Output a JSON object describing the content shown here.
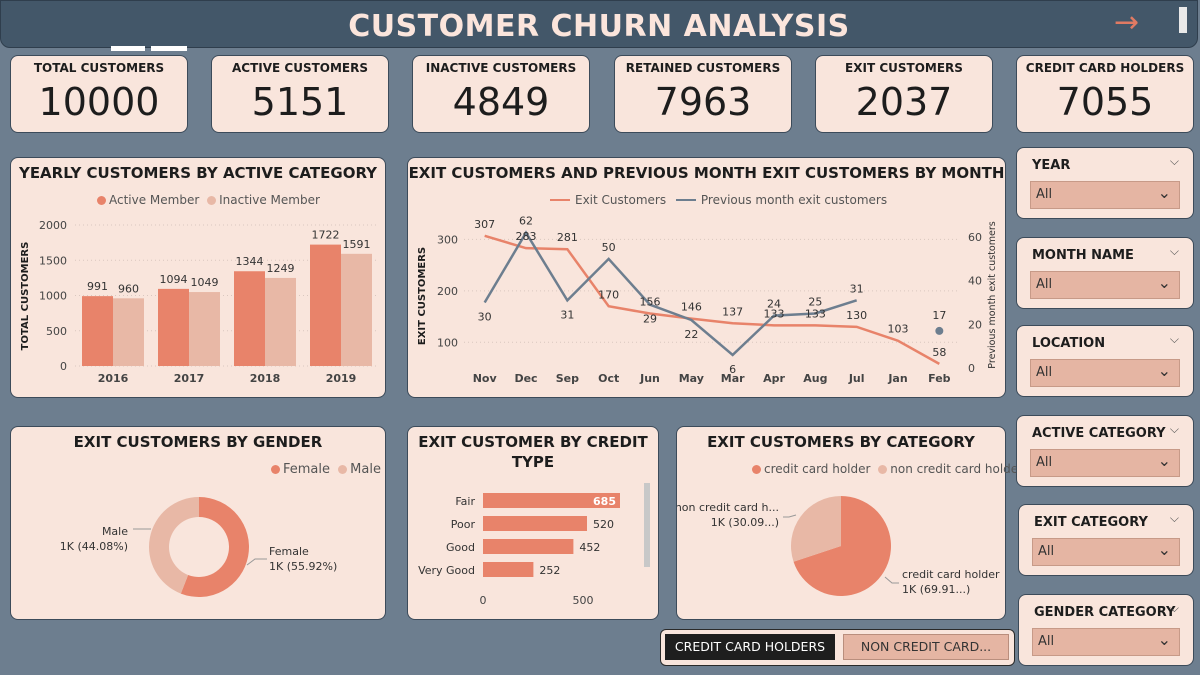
{
  "header": {
    "title": "CUSTOMER CHURN ANALYSIS",
    "nav_icon": "arrow-right-icon"
  },
  "kpis": [
    {
      "label": "TOTAL CUSTOMERS",
      "value": "10000"
    },
    {
      "label": "ACTIVE CUSTOMERS",
      "value": "5151"
    },
    {
      "label": "INACTIVE CUSTOMERS",
      "value": "4849"
    },
    {
      "label": "RETAINED CUSTOMERS",
      "value": "7963"
    },
    {
      "label": "EXIT CUSTOMERS",
      "value": "2037"
    },
    {
      "label": "CREDIT CARD HOLDERS",
      "value": "7055"
    }
  ],
  "colors": {
    "accent": "#e8836a",
    "accent_light": "#e8b8a6",
    "slate": "#6d7e8f",
    "card": "#f9e5dc"
  },
  "slicers": [
    {
      "label": "YEAR",
      "value": "All"
    },
    {
      "label": "MONTH NAME",
      "value": "All"
    },
    {
      "label": "LOCATION",
      "value": "All"
    },
    {
      "label": "ACTIVE CATEGORY",
      "value": "All"
    },
    {
      "label": "EXIT CATEGORY",
      "value": "All"
    },
    {
      "label": "GENDER CATEGORY",
      "value": "All"
    }
  ],
  "buttons": {
    "credit": "CREDIT CARD HOLDERS",
    "noncredit": "NON CREDIT CARD..."
  },
  "chart_data": [
    {
      "id": "yearly",
      "type": "bar",
      "title": "YEARLY CUSTOMERS BY ACTIVE CATEGORY",
      "ylabel": "TOTAL CUSTOMERS",
      "categories": [
        "2016",
        "2017",
        "2018",
        "2019"
      ],
      "series": [
        {
          "name": "Active Member",
          "values": [
            991,
            1094,
            1344,
            1722
          ],
          "color": "#e8836a"
        },
        {
          "name": "Inactive Member",
          "values": [
            960,
            1049,
            1249,
            1591
          ],
          "color": "#e8b8a6"
        }
      ],
      "yticks": [
        "0",
        "500",
        "1000",
        "1500",
        "2000"
      ],
      "ylim": [
        0,
        2000
      ]
    },
    {
      "id": "monthly",
      "type": "line",
      "title": "EXIT CUSTOMERS AND PREVIOUS MONTH EXIT CUSTOMERS BY MONTH",
      "ylabel": "EXIT CUSTOMERS",
      "y2label": "Previous month exit customers",
      "categories": [
        "Nov",
        "Dec",
        "Sep",
        "Oct",
        "Jun",
        "May",
        "Mar",
        "Apr",
        "Aug",
        "Jul",
        "Jan",
        "Feb"
      ],
      "series": [
        {
          "name": "Exit Customers",
          "values": [
            307,
            283,
            281,
            170,
            156,
            146,
            137,
            133,
            133,
            130,
            103,
            58
          ],
          "axis": "left",
          "color": "#e8836a"
        },
        {
          "name": "Previous month exit customers",
          "values": [
            30,
            62,
            31,
            50,
            29,
            22,
            6,
            24,
            25,
            31,
            null,
            17
          ],
          "axis": "right",
          "color": "#6d7e8f"
        }
      ],
      "point_labels_left": [
        "307",
        "283",
        "281",
        "170",
        "156",
        "146",
        "137",
        "133",
        "133",
        "130",
        "103",
        "58"
      ],
      "point_labels_right": [
        "30",
        "62",
        "31",
        "50",
        "29",
        "22",
        "6",
        "24",
        "25",
        "31",
        "",
        "17"
      ],
      "yticks": [
        "100",
        "200",
        "300"
      ],
      "y2ticks": [
        "0",
        "20",
        "40",
        "60"
      ],
      "ylim": [
        50,
        330
      ],
      "y2lim": [
        0,
        66
      ]
    },
    {
      "id": "gender",
      "type": "pie",
      "title": "EXIT CUSTOMERS BY GENDER",
      "labels": [
        "Female",
        "Male"
      ],
      "values": [
        55.92,
        44.08
      ],
      "data_labels": [
        [
          "Female",
          "1K (55.92%)"
        ],
        [
          "Male",
          "1K (44.08%)"
        ]
      ],
      "colors": [
        "#e8836a",
        "#e8b8a6"
      ]
    },
    {
      "id": "credit",
      "type": "bar",
      "title": "EXIT CUSTOMER BY CREDIT TYPE",
      "categories": [
        "Fair",
        "Poor",
        "Good",
        "Very Good"
      ],
      "values": [
        685,
        520,
        452,
        252
      ],
      "value_labels": [
        "685",
        "520",
        "452",
        "252"
      ],
      "xticks": [
        "0",
        "500"
      ],
      "xlim": [
        0,
        750
      ]
    },
    {
      "id": "category",
      "type": "pie",
      "title": "EXIT CUSTOMERS BY CATEGORY",
      "labels": [
        "credit card holder",
        "non credit card holder"
      ],
      "values": [
        69.91,
        30.09
      ],
      "data_labels": [
        [
          "credit card holder",
          "1K (69.91...)"
        ],
        [
          "non credit card h...",
          "1K (30.09...)"
        ]
      ],
      "colors": [
        "#e8836a",
        "#e8b8a6"
      ]
    }
  ]
}
